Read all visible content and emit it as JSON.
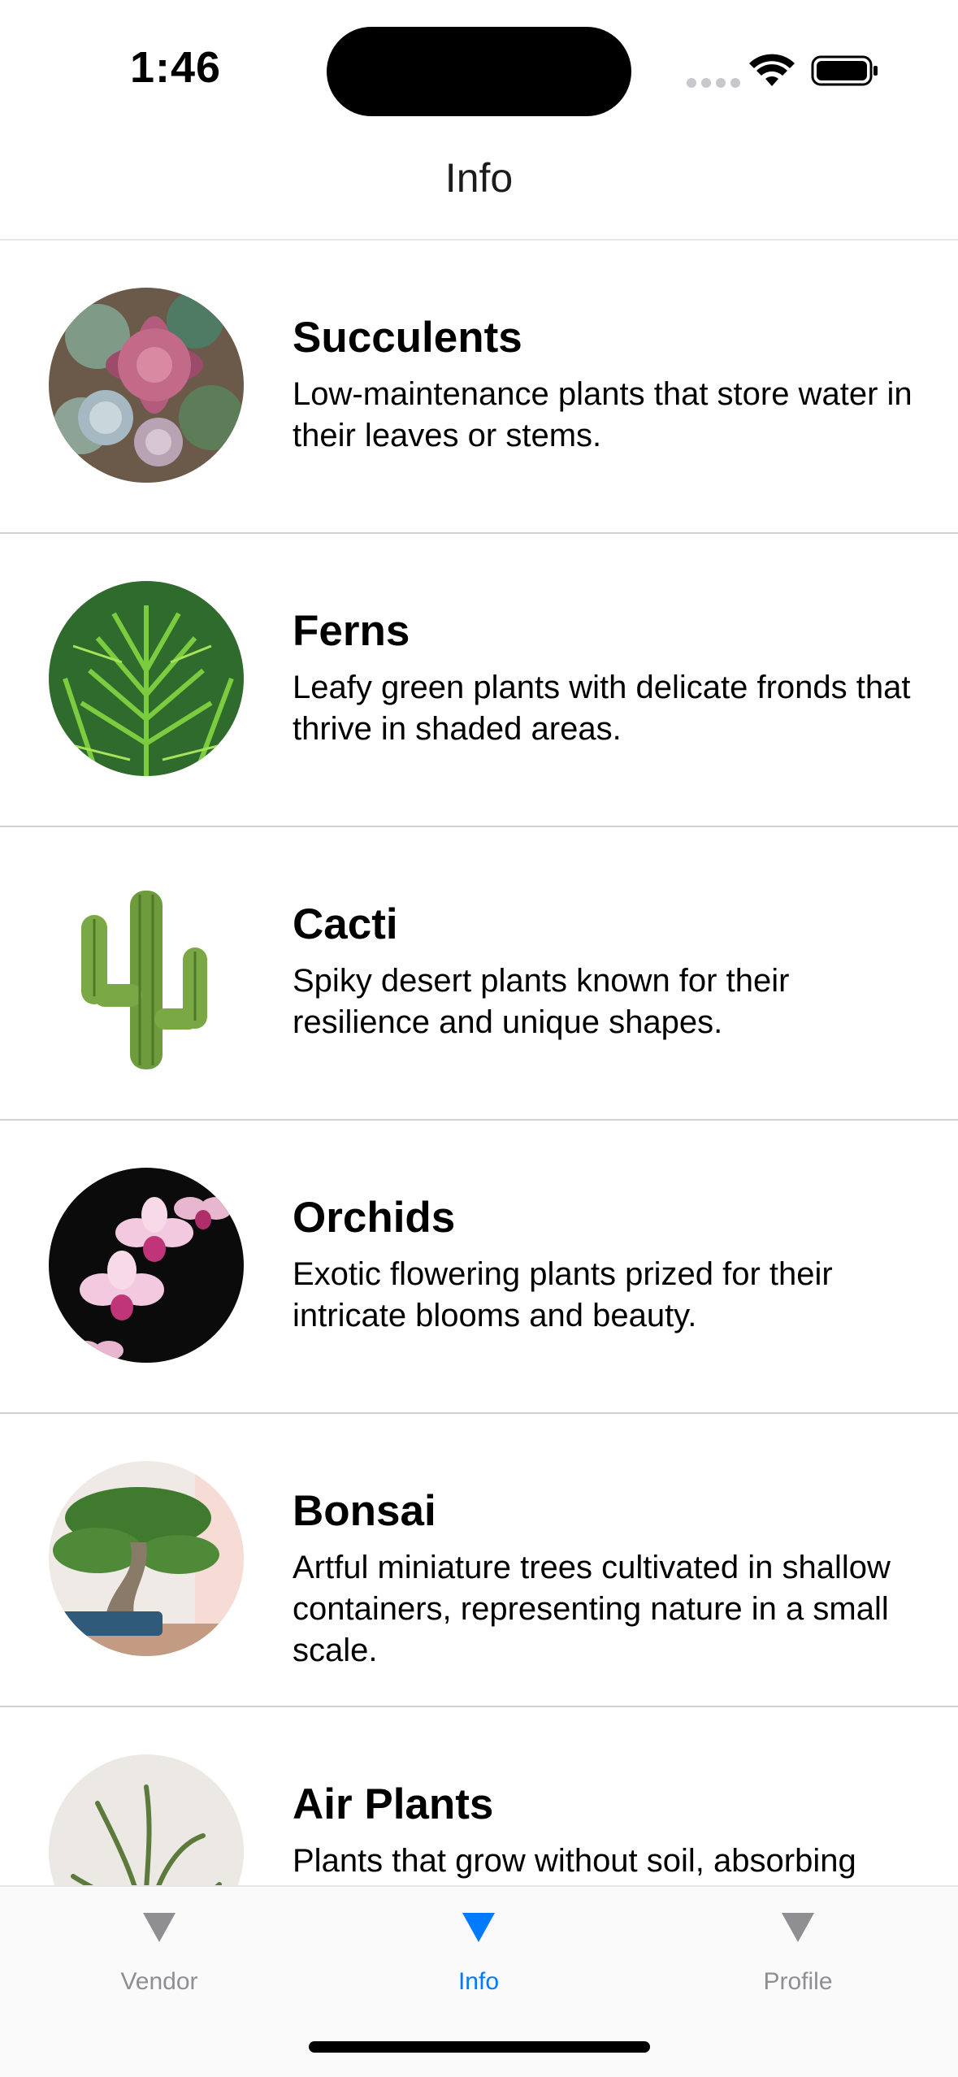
{
  "status_bar": {
    "time": "1:46"
  },
  "nav": {
    "title": "Info"
  },
  "plants": [
    {
      "name": "Succulents",
      "description": "Low-maintenance plants that store water in their leaves or stems.",
      "image_icon": "succulent-image"
    },
    {
      "name": "Ferns",
      "description": "Leafy green plants with delicate fronds that thrive in shaded areas.",
      "image_icon": "fern-image"
    },
    {
      "name": "Cacti",
      "description": "Spiky desert plants known for their resilience and unique shapes.",
      "image_icon": "cactus-image"
    },
    {
      "name": "Orchids",
      "description": "Exotic flowering plants prized for their intricate blooms and beauty.",
      "image_icon": "orchid-image"
    },
    {
      "name": "Bonsai",
      "description": "Artful miniature trees cultivated in shallow containers, representing nature in a small scale.",
      "image_icon": "bonsai-image"
    },
    {
      "name": "Air Plants",
      "description": "Plants that grow without soil, absorbing nutrients and water through their leaves.",
      "image_icon": "air-plant-image"
    }
  ],
  "tab_bar": {
    "tabs": [
      {
        "label": "Vendor",
        "icon": "triangle-down-icon",
        "active": false
      },
      {
        "label": "Info",
        "icon": "triangle-down-icon",
        "active": true
      },
      {
        "label": "Profile",
        "icon": "triangle-down-icon",
        "active": false
      }
    ]
  },
  "colors": {
    "accent": "#007aff",
    "inactive_tab": "#8e8e93",
    "separator": "#d1d1d6"
  }
}
